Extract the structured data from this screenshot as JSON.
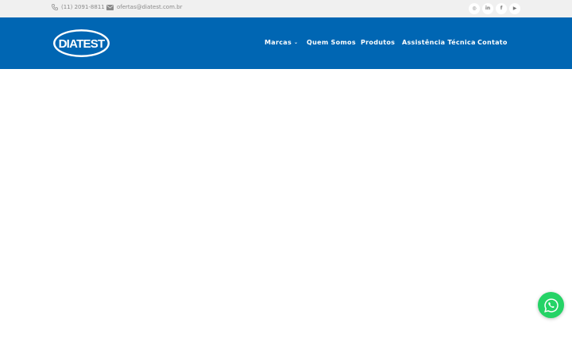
{
  "topbar": {
    "phone": "(11) 2091-8811",
    "email": "ofertas@diatest.com.br",
    "phone_icon": "phone-icon",
    "email_icon": "envelope-icon",
    "socials": [
      {
        "icon": "instagram-icon",
        "glyph": "◎"
      },
      {
        "icon": "linkedin-icon",
        "glyph": "in"
      },
      {
        "icon": "facebook-icon",
        "glyph": "f"
      },
      {
        "icon": "youtube-icon",
        "glyph": "▶"
      }
    ]
  },
  "header": {
    "logo_text": "DIATEST",
    "nav": [
      {
        "label": "Marcas",
        "has_dropdown": true
      },
      {
        "label": "Quem Somos"
      },
      {
        "label": "Produtos"
      },
      {
        "label": "Assistência Técnica"
      },
      {
        "label": "Contato"
      }
    ]
  },
  "whatsapp": {
    "icon": "whatsapp-icon"
  },
  "colors": {
    "brand_blue": "#0066b3",
    "topbar_bg": "#f0f0f0",
    "whatsapp_green": "#25d366"
  }
}
